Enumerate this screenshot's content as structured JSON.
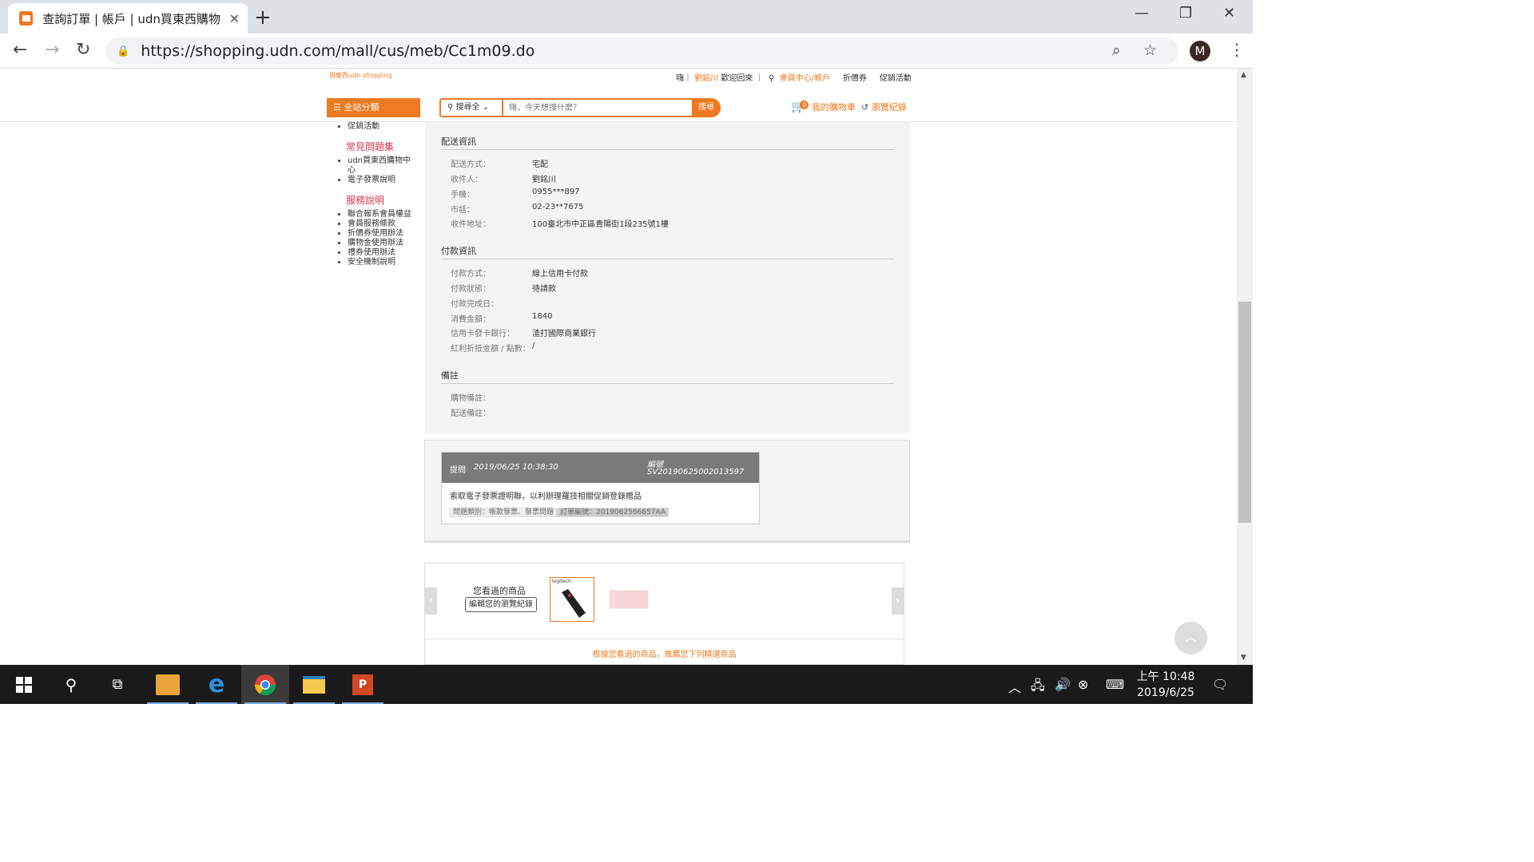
{
  "browser": {
    "tab_title": "查詢訂單 | 帳戶 | udn買東西購物",
    "url": "https://shopping.udn.com/mall/cus/meb/Cc1m09.do",
    "profile_initial": "M"
  },
  "header": {
    "logo_text": "買東西udn shopping",
    "greeting": "嗨｜",
    "user_name": "劉銘川",
    "welcome": "歡迎回來 ｜",
    "member_center": "會員中心/帳戶",
    "coupons": "折價券",
    "promotions": "促銷活動",
    "category_button": "全站分類",
    "search_scope": "搜尋全",
    "search_placeholder": "嗨，今天想搜什麼？",
    "search_button": "搜尋",
    "cart_count": "0",
    "cart_label": "我的購物車",
    "history_label": "瀏覽紀錄"
  },
  "sidebar": {
    "top_item": "促銷活動",
    "faq_heading": "常見問題集",
    "faq_items": [
      "udn買東西購物中",
      "心",
      "電子發票說明"
    ],
    "service_heading": "服務說明",
    "service_items": [
      "聯合報系會員權益",
      "會員服務條款",
      "折價券使用辦法",
      "購物金使用辦法",
      "禮券使用辦法",
      "安全機制說明"
    ]
  },
  "delivery": {
    "title": "配送資訊",
    "rows": [
      {
        "label": "配送方式：",
        "value": "宅配"
      },
      {
        "label": "收件人：",
        "value": "劉銘川"
      },
      {
        "label": "手機：",
        "value": "0955***897"
      },
      {
        "label": "市話：",
        "value": "02-23**7675"
      },
      {
        "label": "收件地址：",
        "value": "100臺北市中正區貴陽街1段235號1樓"
      }
    ]
  },
  "payment": {
    "title": "付款資訊",
    "rows": [
      {
        "label": "付款方式：",
        "value": "線上信用卡付款"
      },
      {
        "label": "付款狀態：",
        "value": "待請款"
      },
      {
        "label": "付款完成日：",
        "value": ""
      },
      {
        "label": "消費金額：",
        "value": "1840"
      },
      {
        "label": "信用卡發卡銀行：",
        "value": "渣打國際商業銀行"
      },
      {
        "label": "紅利折抵金額 / 點數：",
        "value": "/"
      }
    ]
  },
  "notes": {
    "title": "備註",
    "rows": [
      {
        "label": "購物備註：",
        "value": ""
      },
      {
        "label": "配送備註：",
        "value": ""
      }
    ]
  },
  "question": {
    "label": "提問",
    "datetime": "2019/06/25 10:38:30",
    "number_label": "編號",
    "number": "SV20190625002013597",
    "body": "索取電子發票證明聯，以利辦理羅技相關促銷登錄贈品",
    "category": "問題類別：帳款發票、發票問題",
    "order_no": "訂單編號：2019062566657AA"
  },
  "viewed": {
    "title": "您看過的商品",
    "edit_button": "編輯您的瀏覽紀錄",
    "product1_brand": "logitech",
    "recommend": "根據您看過的商品，推薦您下列精選商品"
  },
  "taskbar": {
    "time": "上午 10:48",
    "date": "2019/6/25"
  },
  "colors": {
    "accent": "#ee7a22",
    "sidebar_heading": "#d7354a"
  }
}
